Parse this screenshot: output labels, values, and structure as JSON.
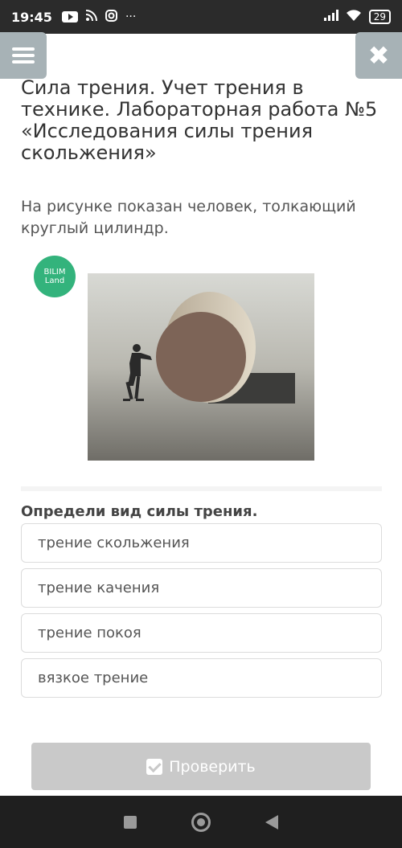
{
  "status_bar": {
    "time": "19:45",
    "more": "···",
    "battery": "29"
  },
  "header": {
    "title": "Сила трения. Учет трения в технике. Лабораторная работа №5 «Исследования силы трения скольжения»"
  },
  "question": {
    "text": "На рисунке показан человек, толкающий круглый цилиндр.",
    "logo_text": "BILIM Land",
    "prompt": "Определи вид силы трения.",
    "options": [
      {
        "label": "трение скольжения"
      },
      {
        "label": "трение качения"
      },
      {
        "label": "трение покоя"
      },
      {
        "label": "вязкое трение"
      }
    ]
  },
  "actions": {
    "check_label": "Проверить"
  },
  "colors": {
    "accent_green": "#33b37c",
    "header_button": "#a7b2b6",
    "disabled_button": "#c9c9c9"
  }
}
